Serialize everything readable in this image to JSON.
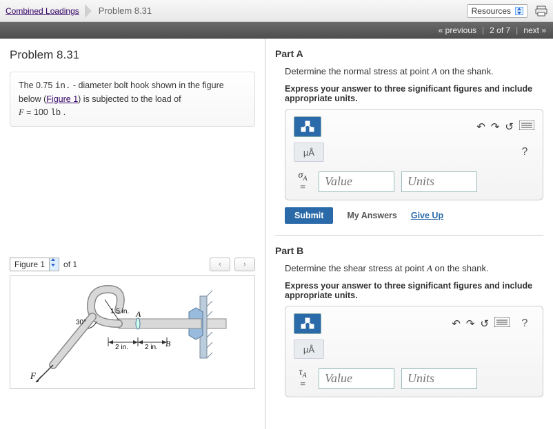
{
  "breadcrumb": {
    "parent": "Combined Loadings",
    "current": "Problem 8.31"
  },
  "topbar": {
    "resources": "Resources"
  },
  "nav": {
    "prev": "« previous",
    "pos": "2 of 7",
    "next": "next »"
  },
  "problem": {
    "title": "Problem 8.31",
    "text_a": "The 0.75 ",
    "unit_in": "in.",
    "text_b": " - diameter bolt hook shown in the figure below (",
    "fig_link": "Figure 1",
    "text_c": ") is subjected to the load of ",
    "F_sym": "F",
    "F_eq": " = 100 ",
    "F_unit": "lb",
    "text_d": " ."
  },
  "figure": {
    "label": "Figure 1",
    "of": "of 1",
    "ann": {
      "angle": "30°",
      "r": "1.5 in.",
      "A": "A",
      "B": "B",
      "d1": "2 in.",
      "d2": "2 in.",
      "F": "F"
    }
  },
  "partA": {
    "title": "Part A",
    "prompt_a": "Determine the normal stress at point ",
    "prompt_pt": "A",
    "prompt_b": " on the shank.",
    "instr": "Express your answer to three significant figures and include appropriate units.",
    "ua": "µÅ",
    "sym": "σ",
    "sub": "A",
    "value_ph": "Value",
    "units_ph": "Units",
    "submit": "Submit",
    "myans": "My Answers",
    "giveup": "Give Up"
  },
  "partB": {
    "title": "Part B",
    "prompt_a": "Determine the shear stress at point ",
    "prompt_pt": "A",
    "prompt_b": " on the shank.",
    "instr": "Express your answer to three significant figures and include appropriate units.",
    "ua": "µÅ",
    "sym": "τ",
    "sub": "A",
    "value_ph": "Value",
    "units_ph": "Units"
  }
}
